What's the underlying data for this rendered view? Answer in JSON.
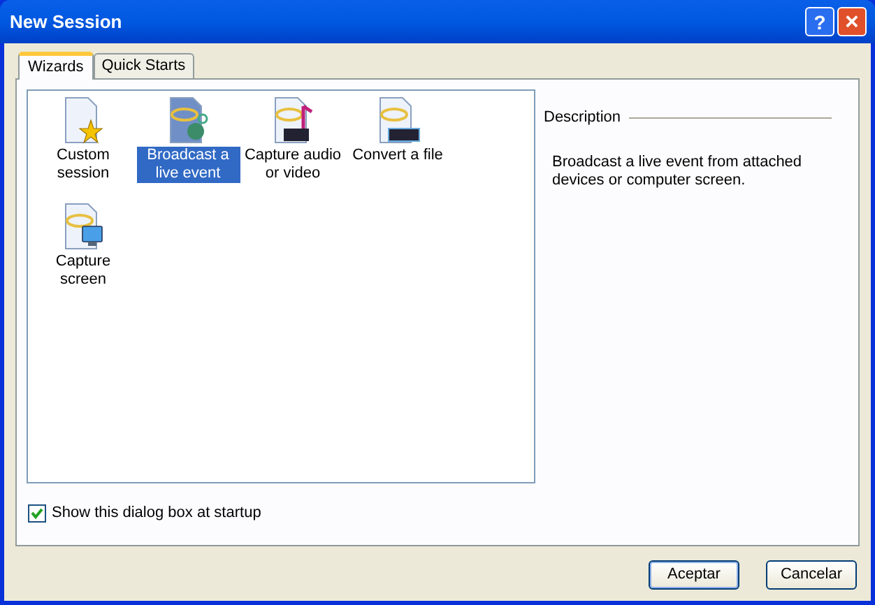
{
  "window": {
    "title": "New Session",
    "help_glyph": "?",
    "close_glyph": "×"
  },
  "tabs": [
    {
      "label": "Wizards",
      "selected": true
    },
    {
      "label": "Quick Starts",
      "selected": false
    }
  ],
  "wizards": [
    {
      "label": "Custom session",
      "selected": false
    },
    {
      "label": "Broadcast a live event",
      "selected": true
    },
    {
      "label": "Capture audio or video",
      "selected": false
    },
    {
      "label": "Convert a file",
      "selected": false
    },
    {
      "label": "Capture screen",
      "selected": false
    }
  ],
  "description": {
    "heading": "Description",
    "text": "Broadcast a live event from attached devices or computer screen."
  },
  "startup_checkbox": {
    "label": "Show this dialog box at startup",
    "checked": true
  },
  "buttons": [
    "Aceptar",
    "Cancelar"
  ]
}
